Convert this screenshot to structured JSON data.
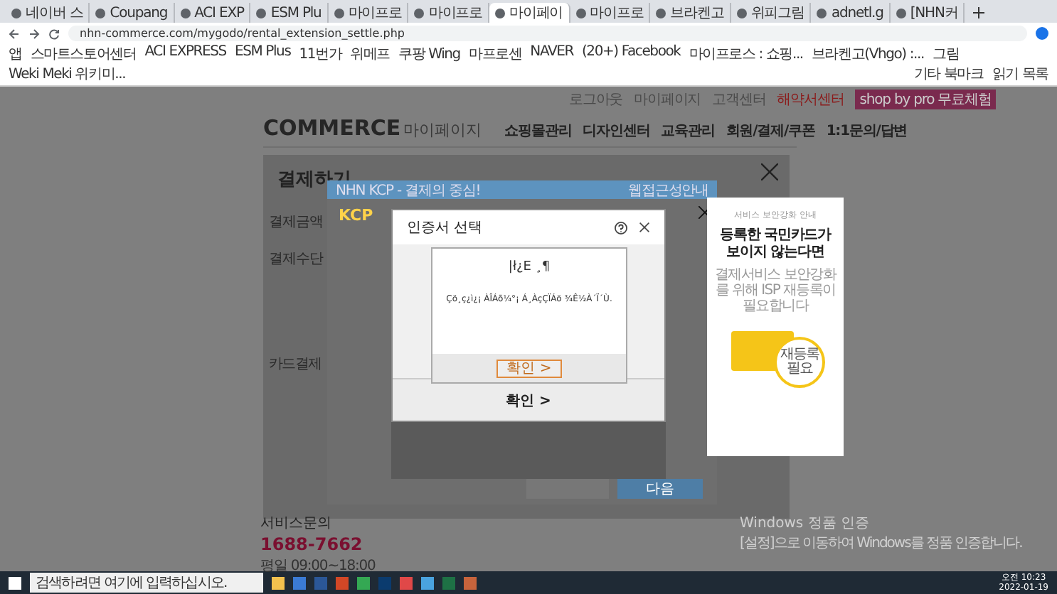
{
  "browser": {
    "tabs": [
      {
        "title": "네이버 스",
        "selected": false
      },
      {
        "title": "Coupang",
        "selected": false
      },
      {
        "title": "ACI EXP",
        "selected": false
      },
      {
        "title": "ESM Plu",
        "selected": false
      },
      {
        "title": "마이프로",
        "selected": false
      },
      {
        "title": "마이프로",
        "selected": false
      },
      {
        "title": "마이페이",
        "selected": true
      },
      {
        "title": "마이프로",
        "selected": false
      },
      {
        "title": "브라켄고",
        "selected": false
      },
      {
        "title": "위피그림",
        "selected": false
      },
      {
        "title": "adnetl.g",
        "selected": false
      },
      {
        "title": "[NHN커",
        "selected": false
      }
    ],
    "url": "nhn-commerce.com/mygodo/rental_extension_settle.php",
    "bookmarks": [
      "앱",
      "스마트스토어센터",
      "ACI EXPRESS",
      "ESM Plus",
      "11번가",
      "위메프",
      "쿠팡 Wing",
      "마프로센",
      "NAVER",
      "(20+) Facebook",
      "마이프로스 : 쇼핑...",
      "브라켄고(Vhgo) :...",
      "그림",
      "Weki Meki 위키미..."
    ],
    "bookmarks_right": [
      "기타 북마크",
      "읽기 목록"
    ]
  },
  "site": {
    "top_links": [
      {
        "label": "로그아웃",
        "kind": "link"
      },
      {
        "label": "마이페이지",
        "kind": "link"
      },
      {
        "label": "고객센터",
        "kind": "link"
      },
      {
        "label": "해약서센터",
        "kind": "alert"
      },
      {
        "label": "shop by pro 무료체험",
        "kind": "promo"
      }
    ],
    "logo": "COMMERCE",
    "logo_sub": "마이페이지",
    "nav": [
      "쇼핑몰관리",
      "디자인센터",
      "교육관리",
      "회원/결제/쿠폰",
      "1:1문의/답변"
    ],
    "service": {
      "title": "서비스문의",
      "phone": "1688-7662",
      "hours": "평일 09:00~18:00"
    }
  },
  "payment_modal": {
    "title": "결제하기",
    "rows": [
      "결제금액",
      "결제수단"
    ],
    "notice": "카드결제"
  },
  "kcp": {
    "header": "NHN KCP - 결제의 중심!",
    "accessibility": "웹접근성안내",
    "logo": "KCP",
    "next_button": "다음"
  },
  "cert_dialog": {
    "title": "인증서 선택",
    "confirm": "확인 >",
    "error": {
      "title": "|ł¿E  ¸¶",
      "message": "Çö¸ç¿ì¿¡ ÀÎÁõ¼­°¡ Á¸ÀçÇÏÁö ¾Ê½À´Ï´Ù.",
      "button": "확인 >"
    }
  },
  "ad": {
    "eyebrow": "서비스 보안강화 안내",
    "headline": "등록한 국민카드가 보이지 않는다면",
    "body": "결제서비스 보안강화를 위해 ISP 재등록이 필요합니다",
    "badge": "재등록 필요"
  },
  "watermark": {
    "title": "Windows 정품 인증",
    "body": "[설정]으로 이동하여 Windows를 정품 인증합니다."
  },
  "taskbar": {
    "search_placeholder": "검색하려면 여기에 입력하십시오.",
    "time": "오전 10:23",
    "date": "2022-01-19"
  }
}
